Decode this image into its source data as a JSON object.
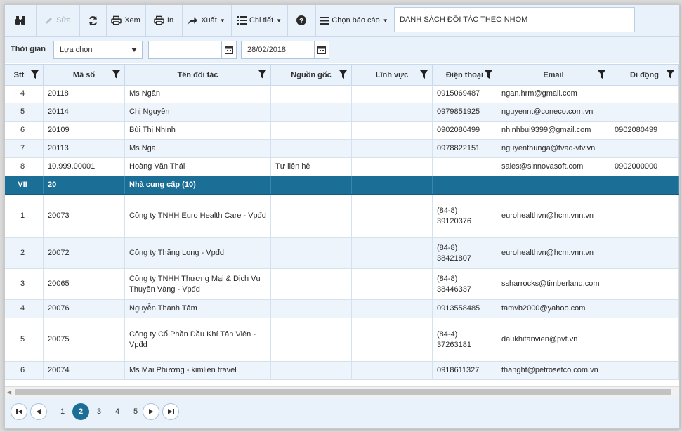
{
  "toolbar": {
    "edit_label": "Sửa",
    "view_label": "Xem",
    "print_label": "In",
    "export_label": "Xuất",
    "detail_label": "Chi tiết",
    "choose_report_label": "Chọn báo cáo",
    "report_title": "DANH SÁCH ĐỐI TÁC THEO NHÓM"
  },
  "filter": {
    "label": "Thời gian",
    "period_value": "Lựa chọn",
    "from_date": "",
    "to_date": "28/02/2018"
  },
  "columns": [
    "Stt",
    "Mã số",
    "Tên đối tác",
    "Nguồn gốc",
    "Lĩnh vực",
    "Điện thoại",
    "Email",
    "Di động"
  ],
  "rows": [
    {
      "stt": "4",
      "ma": "20118",
      "ten": "Ms Ngân",
      "nguon": "",
      "linhvuc": "",
      "dt": "0915069487",
      "email": "ngan.hrm@gmail.com",
      "dd": ""
    },
    {
      "stt": "5",
      "ma": "20114",
      "ten": "Chị Nguyên",
      "nguon": "",
      "linhvuc": "",
      "dt": "0979851925",
      "email": "nguyennt@coneco.com.vn",
      "dd": ""
    },
    {
      "stt": "6",
      "ma": "20109",
      "ten": "Bùi Thị Nhinh",
      "nguon": "",
      "linhvuc": "",
      "dt": "0902080499",
      "email": "nhinhbui9399@gmail.com",
      "dd": "0902080499"
    },
    {
      "stt": "7",
      "ma": "20113",
      "ten": "Ms Nga",
      "nguon": "",
      "linhvuc": "",
      "dt": "0978822151",
      "email": "nguyenthunga@tvad-vtv.vn",
      "dd": ""
    },
    {
      "stt": "8",
      "ma": "10.999.00001",
      "ten": "Hoàng Văn Thái",
      "nguon": "Tự liên hệ",
      "linhvuc": "",
      "dt": "",
      "email": "sales@sinnovasoft.com",
      "dd": "0902000000"
    },
    {
      "group": true,
      "stt": "VII",
      "ma": "20",
      "ten": "Nhà cung cấp (10)"
    },
    {
      "stt": "1",
      "ma": "20073",
      "ten": "Công ty TNHH Euro Health Care - Vpđd",
      "nguon": "",
      "linhvuc": "",
      "dt": "(84-8) 39120376",
      "email": "eurohealthvn@hcm.vnn.vn",
      "dd": ""
    },
    {
      "stt": "2",
      "ma": "20072",
      "ten": "Công ty Thăng Long - Vpđd",
      "nguon": "",
      "linhvuc": "",
      "dt": "(84-8) 38421807",
      "email": "eurohealthvn@hcm.vnn.vn",
      "dd": ""
    },
    {
      "stt": "3",
      "ma": "20065",
      "ten": "Công ty TNHH Thương Mại & Dịch Vụ Thuyền Vàng - Vpđd",
      "nguon": "",
      "linhvuc": "",
      "dt": "(84-8) 38446337",
      "email": "ssharrocks@timberland.com",
      "dd": ""
    },
    {
      "stt": "4",
      "ma": "20076",
      "ten": "Nguyễn Thanh Tâm",
      "nguon": "",
      "linhvuc": "",
      "dt": "0913558485",
      "email": "tamvb2000@yahoo.com",
      "dd": ""
    },
    {
      "stt": "5",
      "ma": "20075",
      "ten": "Công ty Cổ Phần Dầu Khí Tản Viên - Vpđd",
      "nguon": "",
      "linhvuc": "",
      "dt": "(84-4) 37263181",
      "email": "daukhitanvien@pvt.vn",
      "dd": ""
    },
    {
      "stt": "6",
      "ma": "20074",
      "ten": "Ms Mai Phương - kimlien travel",
      "nguon": "",
      "linhvuc": "",
      "dt": "0918611327",
      "email": "thanght@petrosetco.com.vn",
      "dd": ""
    }
  ],
  "pager": {
    "pages": [
      "1",
      "2",
      "3",
      "4",
      "5"
    ],
    "current": "2"
  },
  "colors": {
    "accent": "#1b6e96",
    "toolbar_bg": "#e9f2fa",
    "row_alt": "#edf4fb"
  }
}
